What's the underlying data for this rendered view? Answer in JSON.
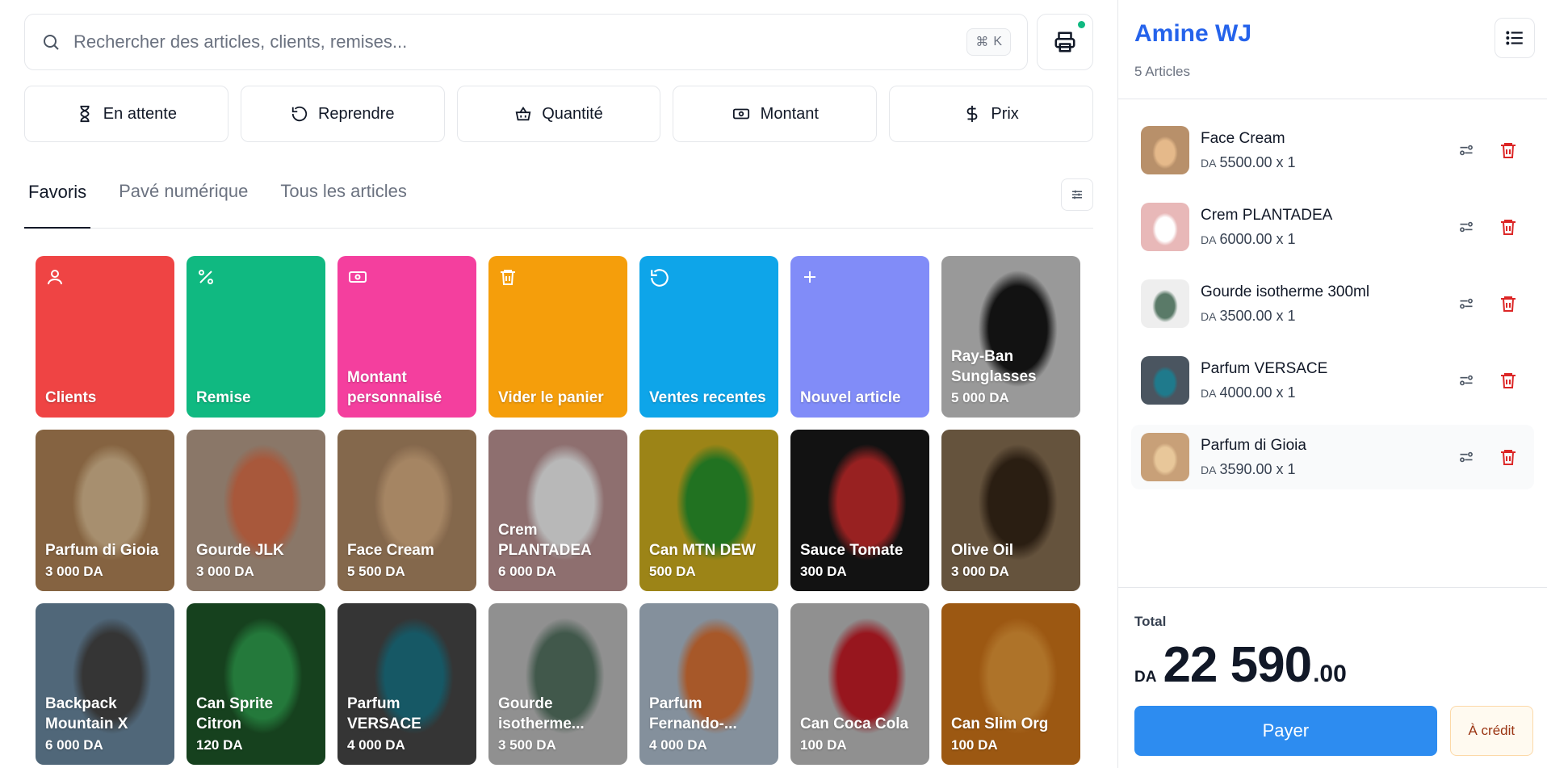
{
  "search": {
    "placeholder": "Rechercher des articles, clients, remises...",
    "shortcut_symbol": "⌘",
    "shortcut_key": "K"
  },
  "actions": [
    {
      "label": "En attente",
      "icon": "hourglass-icon"
    },
    {
      "label": "Reprendre",
      "icon": "rotate-ccw-icon"
    },
    {
      "label": "Quantité",
      "icon": "basket-icon"
    },
    {
      "label": "Montant",
      "icon": "banknote-icon"
    },
    {
      "label": "Prix",
      "icon": "dollar-icon"
    }
  ],
  "tabs": [
    {
      "label": "Favoris",
      "active": true
    },
    {
      "label": "Pavé numérique",
      "active": false
    },
    {
      "label": "Tous les articles",
      "active": false
    }
  ],
  "shortcuts": [
    {
      "label": "Clients",
      "color": "#ef4444",
      "icon": "user-icon"
    },
    {
      "label": "Remise",
      "color": "#10b981",
      "icon": "percent-icon"
    },
    {
      "label": "Montant personnalisé",
      "color": "#f43f9e",
      "icon": "banknote-icon"
    },
    {
      "label": "Vider le panier",
      "color": "#f59e0b",
      "icon": "trash-icon"
    },
    {
      "label": "Ventes recentes",
      "color": "#0ea5e9",
      "icon": "history-icon"
    },
    {
      "label": "Nouvel article",
      "color": "#818cf8",
      "icon": "plus-icon"
    }
  ],
  "products": [
    {
      "name": "Ray-Ban Sunglasses",
      "price": "5 000 DA",
      "bg": "#d4d4d4",
      "accent": "#1a1a1a"
    },
    {
      "name": "Parfum di Gioia",
      "price": "3 000 DA",
      "bg": "#b98a5a",
      "accent": "#e8c79a"
    },
    {
      "name": "Gourde JLK",
      "price": "3 000 DA",
      "bg": "#bfa590",
      "accent": "#e97a52"
    },
    {
      "name": "Face Cream",
      "price": "5 500 DA",
      "bg": "#b8906a",
      "accent": "#e5b98a"
    },
    {
      "name": "Crem PLANTADEA",
      "price": "6 000 DA",
      "bg": "#c59a9a",
      "accent": "#ffffff"
    },
    {
      "name": "Can MTN DEW",
      "price": "500 DA",
      "bg": "#d8b820",
      "accent": "#2f9e2f"
    },
    {
      "name": "Sauce Tomate",
      "price": "300 DA",
      "bg": "#1a1a1a",
      "accent": "#d32f2f"
    },
    {
      "name": "Olive Oil",
      "price": "3 000 DA",
      "bg": "#8c7355",
      "accent": "#3b2a1a"
    },
    {
      "name": "Backpack Mountain X",
      "price": "6 000 DA",
      "bg": "#6f8fa8",
      "accent": "#4a4a4a"
    },
    {
      "name": "Can Sprite Citron",
      "price": "120 DA",
      "bg": "#1f5a2a",
      "accent": "#32a852"
    },
    {
      "name": "Parfum VERSACE",
      "price": "4 000 DA",
      "bg": "#4a4a4a",
      "accent": "#1f7a8c"
    },
    {
      "name": "Gourde isotherme...",
      "price": "3 500 DA",
      "bg": "#c8c8c8",
      "accent": "#5a7a68"
    },
    {
      "name": "Parfum Fernando-...",
      "price": "4 000 DA",
      "bg": "#b8c8d8",
      "accent": "#e87a3a"
    },
    {
      "name": "Can Coca Cola",
      "price": "100 DA",
      "bg": "#c8c8c8",
      "accent": "#d11f2a"
    },
    {
      "name": "Can Slim Org",
      "price": "100 DA",
      "bg": "#d97a1a",
      "accent": "#f2a03a"
    }
  ],
  "cart": {
    "customer": "Amine WJ",
    "count_label": "5 Articles",
    "currency": "DA",
    "items": [
      {
        "name": "Face Cream",
        "price": "5500.00 x 1",
        "bg": "#b8906a",
        "accent": "#e5b98a"
      },
      {
        "name": "Crem PLANTADEA",
        "price": "6000.00 x 1",
        "bg": "#e8b8b8",
        "accent": "#ffffff"
      },
      {
        "name": "Gourde isotherme 300ml",
        "price": "3500.00 x 1",
        "bg": "#eeeeee",
        "accent": "#5a7a68"
      },
      {
        "name": "Parfum VERSACE",
        "price": "4000.00 x 1",
        "bg": "#4a5560",
        "accent": "#1f7a8c"
      },
      {
        "name": "Parfum di Gioia",
        "price": "3590.00 x 1",
        "bg": "#c8a078",
        "accent": "#e8c79a"
      }
    ],
    "total_label": "Total",
    "total_int": "22 590",
    "total_dec": ".00",
    "pay_label": "Payer",
    "credit_label": "À crédit"
  },
  "colors": {
    "accent": "#2563eb",
    "pay": "#2d8cf0",
    "delete": "#dc2626",
    "online": "#10b981"
  }
}
